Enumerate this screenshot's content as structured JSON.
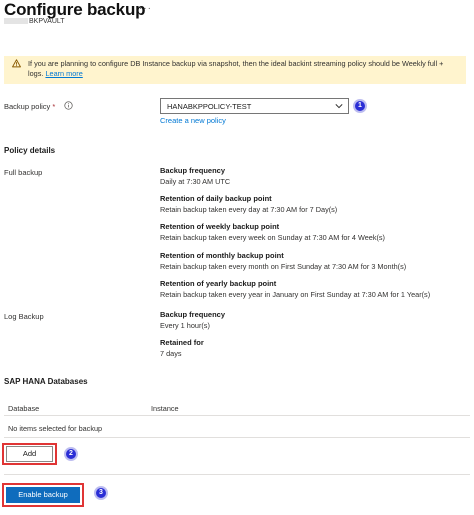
{
  "header": {
    "title": "Configure backup",
    "more_glyph": "···",
    "vault_name": "BKPVAULT"
  },
  "banner": {
    "icon": "warning-icon",
    "text": "If you are planning to configure DB Instance backup via snapshot, then the ideal backint streaming policy should be Weekly full + logs.",
    "link": "Learn more"
  },
  "policy": {
    "label": "Backup policy",
    "required": "*",
    "info_icon": "info-icon",
    "selected": "HANABKPPOLICY-TEST",
    "create_link": "Create a new policy",
    "step": "1"
  },
  "details": {
    "title": "Policy details",
    "full_backup_label": "Full backup",
    "full_backup": [
      {
        "heading": "Backup frequency",
        "value": "Daily at 7:30 AM UTC"
      },
      {
        "heading": "Retention of daily backup point",
        "value": "Retain backup taken every day at 7:30 AM for 7 Day(s)"
      },
      {
        "heading": "Retention of weekly backup point",
        "value": "Retain backup taken every week on Sunday at 7:30 AM for 4 Week(s)"
      },
      {
        "heading": "Retention of monthly backup point",
        "value": "Retain backup taken every month on First Sunday at 7:30 AM for 3 Month(s)"
      },
      {
        "heading": "Retention of yearly backup point",
        "value": "Retain backup taken every year in January on First Sunday at 7:30 AM for 1 Year(s)"
      }
    ],
    "log_backup_label": "Log Backup",
    "log_backup": [
      {
        "heading": "Backup frequency",
        "value": "Every 1 hour(s)"
      },
      {
        "heading": "Retained for",
        "value": "7 days"
      }
    ]
  },
  "databases": {
    "title": "SAP HANA Databases",
    "columns": [
      "Database",
      "Instance"
    ],
    "empty_text": "No items selected for backup",
    "add_button": "Add",
    "step": "2"
  },
  "footer": {
    "enable_button": "Enable backup",
    "step": "3"
  },
  "colors": {
    "accent": "#0078d4",
    "primary_button": "#0f6cbd",
    "warning_bg": "#fff4ce",
    "highlight_border": "#e03535",
    "step_badge": "#2b2ed6"
  }
}
